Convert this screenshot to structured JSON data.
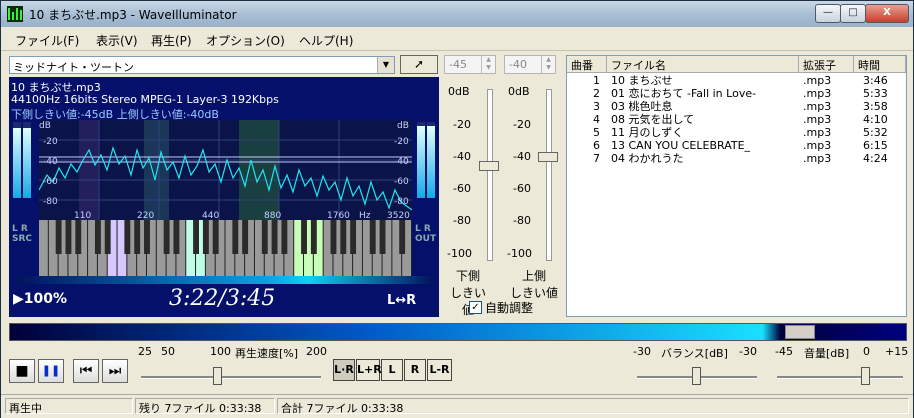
{
  "window": {
    "title": "10 まちぶせ.mp3 - WaveIlluminator"
  },
  "title_buttons": {
    "minimize": "—",
    "maximize": "□",
    "close": "X"
  },
  "menu": [
    "ファイル(F)",
    "表示(V)",
    "再生(P)",
    "オプション(O)",
    "ヘルプ(H)"
  ],
  "theme_select": {
    "value": "ミッドナイト・ツートン",
    "arrow": "▼"
  },
  "pointer_button": "➚",
  "threshold_inputs": {
    "lower": "-45",
    "upper": "-40"
  },
  "visual": {
    "file": "10 まちぶせ.mp3",
    "format": "44100Hz  16bits  Stereo  MPEG-1  Layer-3  192Kbps",
    "thresholds": "下側しきい値:-45dB    上側しきい値:-40dB",
    "db_unit": "dB",
    "db_labels": [
      "-20",
      "-40",
      "-60",
      "-80"
    ],
    "freq_labels": [
      "110",
      "220",
      "440",
      "880",
      "1760",
      "Hz",
      "3520"
    ],
    "src_label": [
      "L",
      "R",
      "S",
      "R",
      "C"
    ],
    "out_label": [
      "L",
      "R",
      "O",
      "U",
      "T"
    ],
    "speed": "100%",
    "time": "3:22/3:45",
    "channel": "L↔R"
  },
  "threshold_sliders": {
    "scale": [
      "0dB",
      "-20",
      "-40",
      "-60",
      "-80",
      "-100"
    ],
    "lower_label_1": "下側",
    "lower_label_2": "しきい値",
    "upper_label_1": "上側",
    "upper_label_2": "しきい値",
    "lower_level": -45,
    "upper_level": -40,
    "auto_adjust_label": "自動調整",
    "auto_adjust_checked": "✓"
  },
  "playlist": {
    "columns": [
      "曲番",
      "ファイル名",
      "拡張子",
      "時間"
    ],
    "rows": [
      {
        "no": "1",
        "name": "10 まちぶせ",
        "ext": ".mp3",
        "time": "3:46"
      },
      {
        "no": "2",
        "name": "01 恋におちて -Fall in Love-",
        "ext": ".mp3",
        "time": "5:33"
      },
      {
        "no": "3",
        "name": "03 桃色吐息",
        "ext": ".mp3",
        "time": "3:58"
      },
      {
        "no": "4",
        "name": "08 元気を出して",
        "ext": ".mp3",
        "time": "4:10"
      },
      {
        "no": "5",
        "name": "11 月のしずく",
        "ext": ".mp3",
        "time": "5:32"
      },
      {
        "no": "6",
        "name": "13 CAN YOU CELEBRATE_",
        "ext": ".mp3",
        "time": "6:15"
      },
      {
        "no": "7",
        "name": "04 わかれうた",
        "ext": ".mp3",
        "time": "4:24"
      }
    ]
  },
  "position_fraction": 0.86,
  "transport": {
    "stop": "■",
    "pause": "❚❚",
    "prev": "⏮",
    "next": "⏭"
  },
  "speed": {
    "ticks": [
      "25",
      "50",
      "100",
      "200"
    ],
    "label": "再生速度[%]",
    "value": 100
  },
  "channel_buttons": [
    "L·R",
    "L+R",
    "L",
    "R",
    "L-R"
  ],
  "balance": {
    "left": "-30",
    "label": "バランス[dB]",
    "right": "-30",
    "value": 0
  },
  "volume": {
    "min": "-45",
    "label": "音量[dB]",
    "mid": "0",
    "max": "+15",
    "value": 0
  },
  "status": {
    "state": "再生中",
    "remaining": "残り 7ファイル 0:33:38",
    "total": "合計 7ファイル 0:33:38"
  }
}
